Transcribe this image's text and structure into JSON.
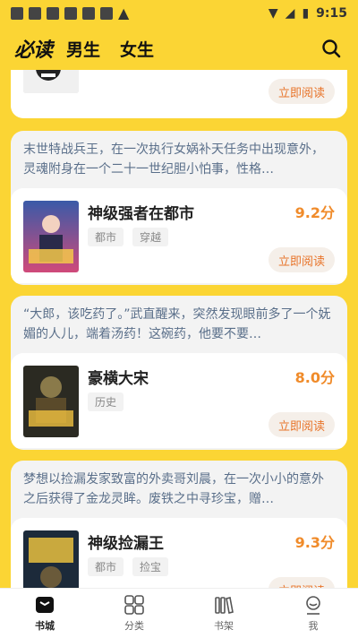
{
  "status_bar": {
    "time": "9:15"
  },
  "header": {
    "logo": "必读",
    "tabs": [
      "男生",
      "女生"
    ]
  },
  "books": [
    {
      "desc": "",
      "title": "",
      "score": "",
      "tags": [],
      "read_label": "立即阅读"
    },
    {
      "desc": "末世特战兵王，在一次执行女娲补天任务中出现意外，灵魂附身在一个二十一世纪胆小怕事，性格…",
      "title": "神级强者在都市",
      "score": "9.2分",
      "tags": [
        "都市",
        "穿越"
      ],
      "read_label": "立即阅读"
    },
    {
      "desc": "“大郎，该吃药了。”武直醒来，突然发现眼前多了一个妩媚的人儿，端着汤药！这碗药，他要不要…",
      "title": "豪横大宋",
      "score": "8.0分",
      "tags": [
        "历史"
      ],
      "read_label": "立即阅读"
    },
    {
      "desc": "梦想以捡漏发家致富的外卖哥刘晨，在一次小小的意外之后获得了金龙灵眸。废铁之中寻珍宝，赠…",
      "title": "神级捡漏王",
      "score": "9.3分",
      "tags": [
        "都市",
        "捡宝"
      ],
      "read_label": "立即阅读"
    }
  ],
  "bottom_nav": [
    {
      "label": "书城",
      "icon": "bookstore-icon",
      "active": true
    },
    {
      "label": "分类",
      "icon": "category-icon",
      "active": false
    },
    {
      "label": "书架",
      "icon": "bookshelf-icon",
      "active": false
    },
    {
      "label": "我",
      "icon": "profile-icon",
      "active": false
    }
  ],
  "colors": {
    "accent": "#fbd534",
    "score": "#f08b2a",
    "button_text": "#e8742a"
  }
}
